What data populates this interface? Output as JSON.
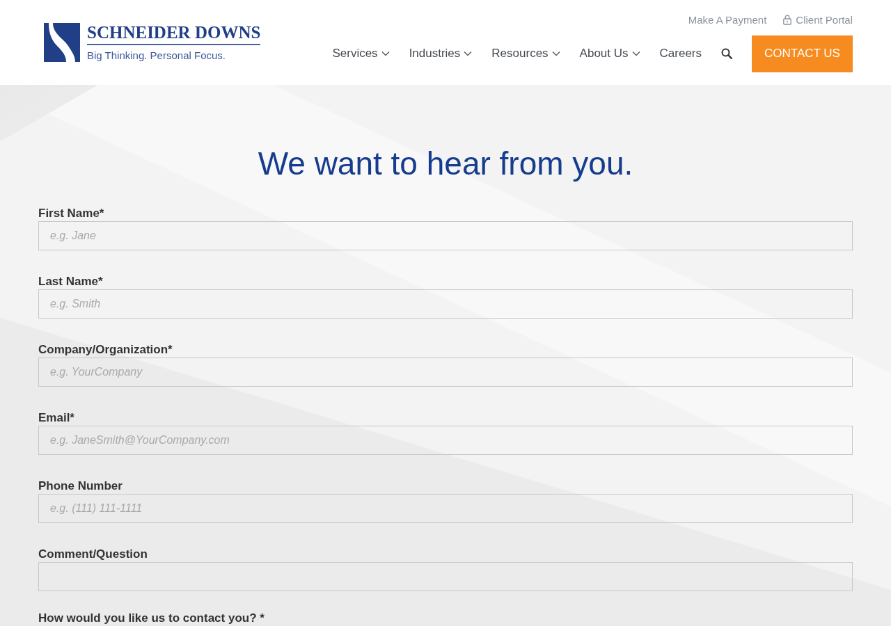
{
  "header": {
    "logo": {
      "wordmark": "SCHNEIDER DOWNS",
      "tagline": "Big Thinking. Personal Focus."
    },
    "utility_links": [
      {
        "label": "Make A Payment",
        "kind": "plain"
      },
      {
        "label": "Client Portal",
        "kind": "secure"
      }
    ],
    "nav": [
      {
        "label": "Services",
        "dropdown": true
      },
      {
        "label": "Industries",
        "dropdown": true
      },
      {
        "label": "Resources",
        "dropdown": true
      },
      {
        "label": "About Us",
        "dropdown": true
      },
      {
        "label": "Careers",
        "dropdown": false
      }
    ],
    "cta": "CONTACT US"
  },
  "heading": "We want to hear from you.",
  "form": {
    "fields": [
      {
        "label": "First Name*",
        "placeholder": "e.g. Jane"
      },
      {
        "label": "Last Name*",
        "placeholder": "e.g. Smith"
      },
      {
        "label": "Company/Organization*",
        "placeholder": "e.g. YourCompany"
      },
      {
        "label": "Email*",
        "placeholder": "e.g. JaneSmith@YourCompany.com"
      },
      {
        "label": "Phone Number",
        "placeholder": "e.g. (111) 111-1111"
      },
      {
        "label": "Comment/Question"
      }
    ],
    "contact_question": "How would you like us to contact you? *"
  }
}
